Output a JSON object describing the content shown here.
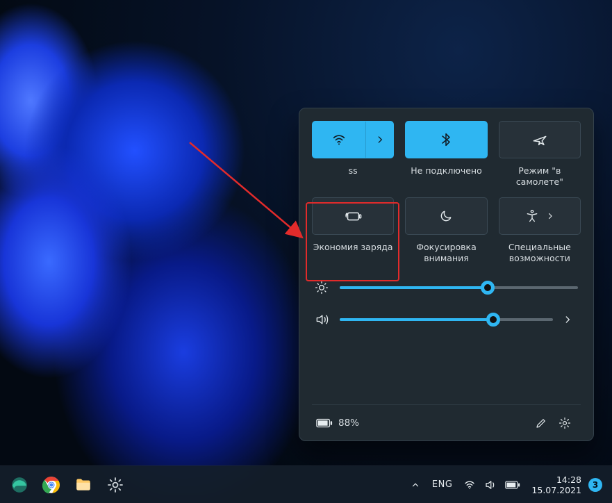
{
  "quick_settings": {
    "tiles": [
      {
        "id": "wifi",
        "label": "ss",
        "active": true,
        "icon": "wifi-icon",
        "has_chevron": true
      },
      {
        "id": "bluetooth",
        "label": "Не подключено",
        "active": true,
        "icon": "bluetooth-icon",
        "has_chevron": false
      },
      {
        "id": "airplane",
        "label": "Режим \"в самолете\"",
        "active": false,
        "icon": "airplane-icon",
        "has_chevron": false
      },
      {
        "id": "batterysaver",
        "label": "Экономия заряда",
        "active": false,
        "icon": "battery-saver-icon",
        "has_chevron": false
      },
      {
        "id": "focus",
        "label": "Фокусировка внимания",
        "active": false,
        "icon": "moon-icon",
        "has_chevron": false
      },
      {
        "id": "accessibility",
        "label": "Специальные возможности",
        "active": false,
        "icon": "accessibility-icon",
        "has_chevron": true
      }
    ],
    "brightness_percent": 62,
    "volume_percent": 72,
    "battery_text": "88%"
  },
  "annotation": {
    "highlighted_tile_id": "batterysaver",
    "arrow_color": "#e22b2b"
  },
  "taskbar": {
    "language": "ENG",
    "time": "14:28",
    "date": "15.07.2021",
    "notification_count": "3"
  }
}
